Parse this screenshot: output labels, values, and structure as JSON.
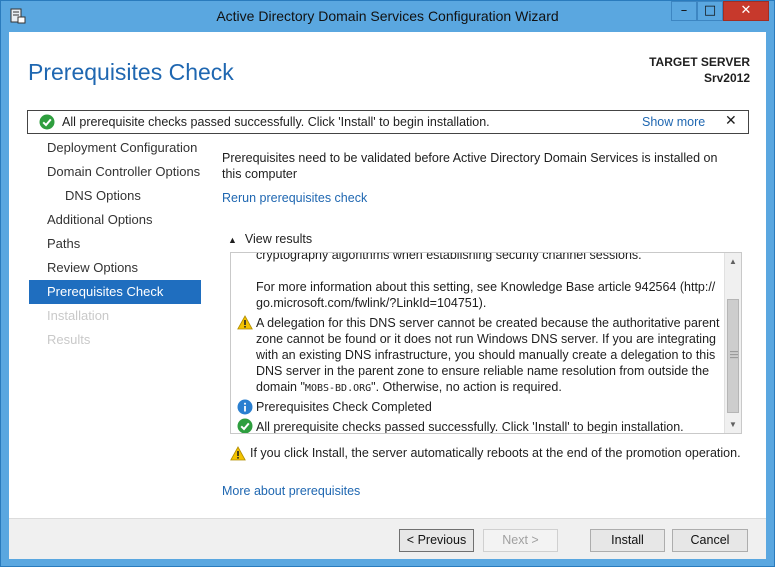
{
  "window": {
    "title": "Active Directory Domain Services Configuration Wizard",
    "controls": {
      "minimize": "–",
      "maximize": "□",
      "close": "✕"
    }
  },
  "header": {
    "page_title": "Prerequisites Check",
    "target_server_label": "TARGET SERVER",
    "target_server_name": "Srv2012"
  },
  "notification": {
    "text": "All prerequisite checks passed successfully.  Click 'Install' to begin installation.",
    "show_more": "Show more",
    "close": "✕"
  },
  "nav": {
    "items": [
      {
        "label": "Deployment Configuration",
        "state": "normal"
      },
      {
        "label": "Domain Controller Options",
        "state": "normal"
      },
      {
        "label": "DNS Options",
        "state": "sub"
      },
      {
        "label": "Additional Options",
        "state": "normal"
      },
      {
        "label": "Paths",
        "state": "normal"
      },
      {
        "label": "Review Options",
        "state": "normal"
      },
      {
        "label": "Prerequisites Check",
        "state": "selected"
      },
      {
        "label": "Installation",
        "state": "disabled"
      },
      {
        "label": "Results",
        "state": "disabled"
      }
    ]
  },
  "content": {
    "intro": "Prerequisites need to be validated before Active Directory Domain Services is installed on this computer",
    "rerun_link": "Rerun prerequisites check",
    "view_results": "View results",
    "results": {
      "cut_line": "cryptography algorithms when establishing security channel sessions.",
      "kb_line1": "For more information about this setting, see Knowledge Base article 942564 (http://",
      "kb_line2": "go.microsoft.com/fwlink/?LinkId=104751).",
      "dns_warning": {
        "line1": "A delegation for this DNS server cannot be created because the authoritative parent",
        "line2": "zone cannot be found or it does not run Windows DNS server. If you are integrating",
        "line3": "with an existing DNS infrastructure, you should manually create a delegation to this",
        "line4": "DNS server in the parent zone to ensure reliable name resolution from outside the",
        "line5_pre": "domain \"",
        "line5_domain": "MOBS-BD.ORG",
        "line5_post": "\". Otherwise, no action is required."
      },
      "completed": "Prerequisites Check Completed",
      "passed": "All prerequisite checks passed successfully.  Click 'Install' to begin installation."
    },
    "reboot_warning": "If you click Install, the server automatically reboots at the end of the promotion operation.",
    "more_link": "More about prerequisites"
  },
  "buttons": {
    "previous": "< Previous",
    "next": "Next >",
    "install": "Install",
    "cancel": "Cancel"
  },
  "colors": {
    "accent": "#1f67b1",
    "selected_nav": "#1f6ebf",
    "titlebar": "#5aa7e0",
    "close_button": "#c7392c",
    "success": "#2e9e3e",
    "warning": "#f2c200",
    "info": "#2a7fd0"
  },
  "icons": {
    "app": "server-wizard-icon",
    "success": "check-circle-icon",
    "warning": "warning-triangle-icon",
    "info": "info-circle-icon",
    "expand": "chevron-up-icon"
  }
}
